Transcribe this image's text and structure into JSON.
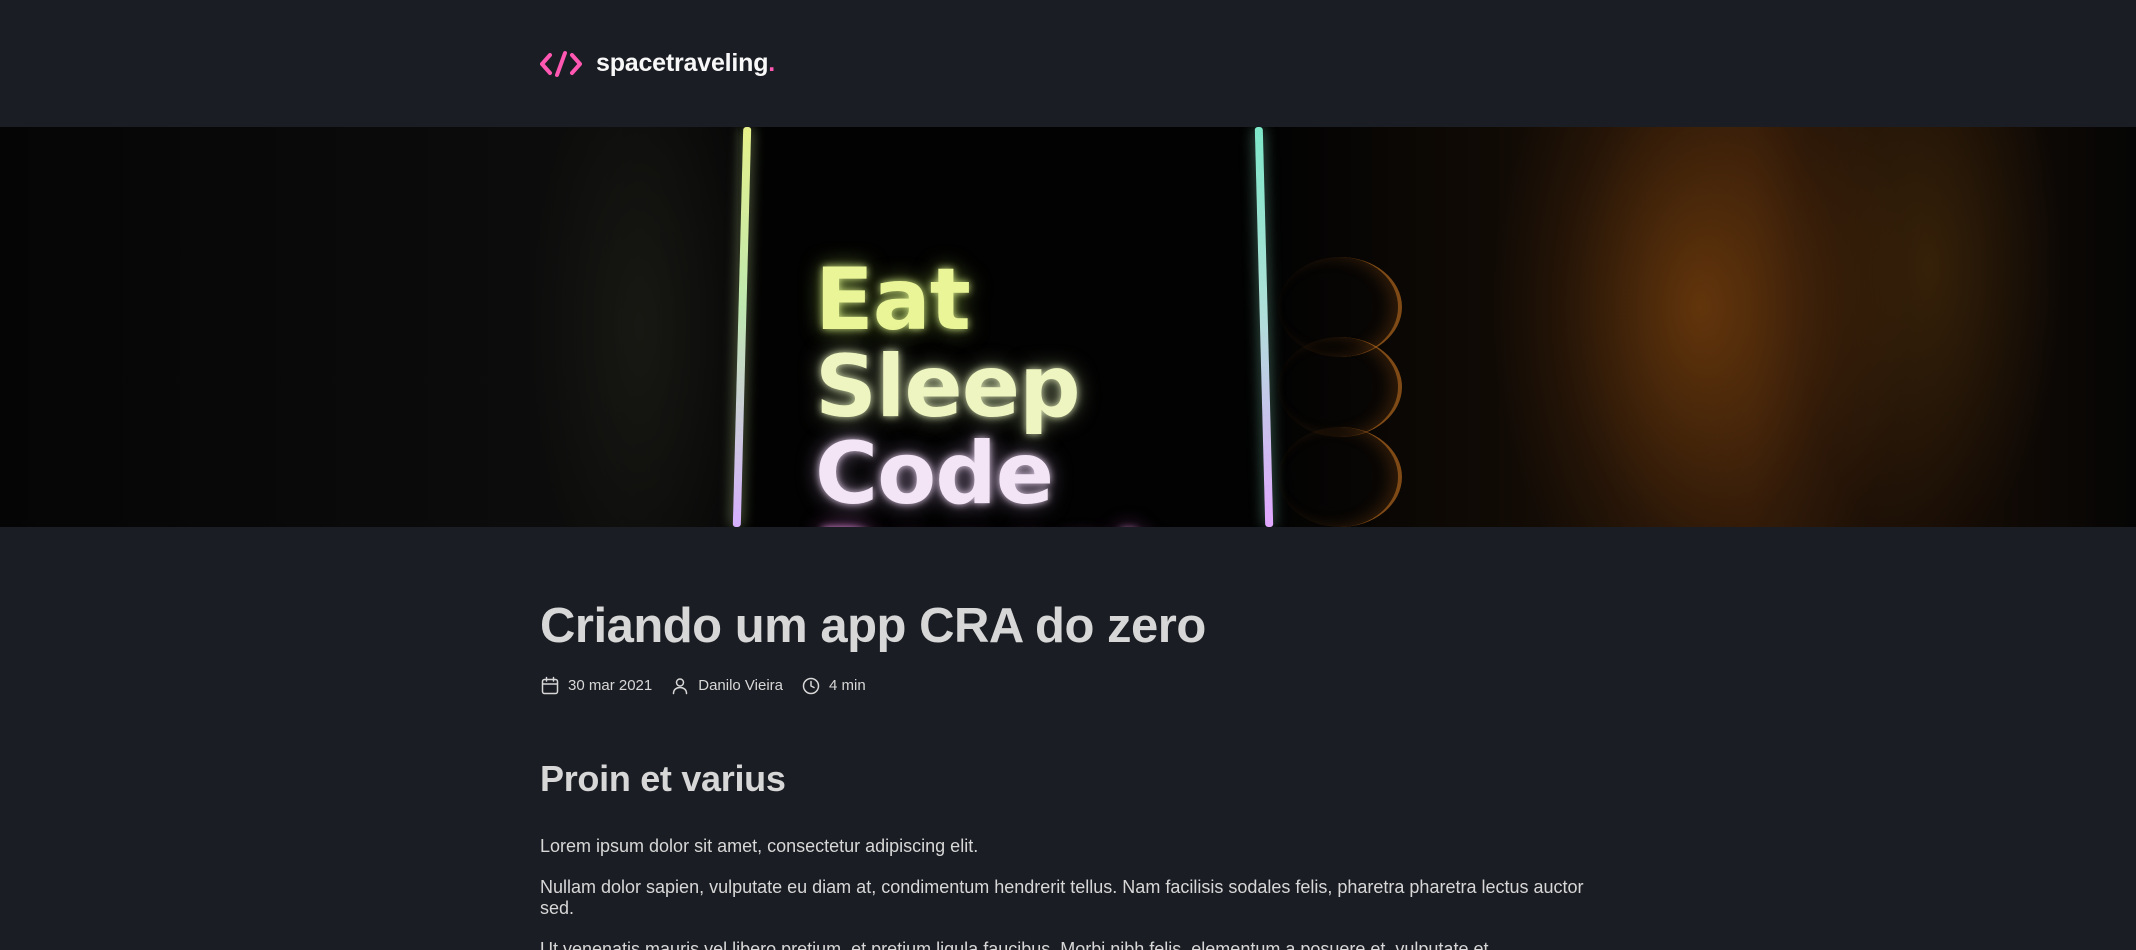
{
  "header": {
    "logo_text": "spacetraveling",
    "logo_dot": ".",
    "logo_icon": "code-brackets-icon",
    "accent_color": "#ff57b2"
  },
  "banner": {
    "image_lines": [
      "Eat",
      "Sleep",
      "Code",
      "Repeat"
    ]
  },
  "post": {
    "title": "Criando um app CRA do zero",
    "meta": {
      "date": "30 mar 2021",
      "date_icon": "calendar-icon",
      "author": "Danilo Vieira",
      "author_icon": "user-icon",
      "reading_time": "4 min",
      "reading_time_icon": "clock-icon"
    },
    "sections": [
      {
        "heading": "Proin et varius",
        "paragraphs": [
          "Lorem ipsum dolor sit amet, consectetur adipiscing elit.",
          "Nullam dolor sapien, vulputate eu diam at, condimentum hendrerit tellus. Nam facilisis sodales felis, pharetra pharetra lectus auctor sed.",
          "Ut venenatis mauris vel libero pretium, et pretium ligula faucibus. Morbi nibh felis, elementum a posuere et, vulputate et"
        ]
      }
    ]
  },
  "colors": {
    "background": "#1a1d23",
    "text": "#d7d7d7",
    "heading": "#d7d7d7"
  }
}
